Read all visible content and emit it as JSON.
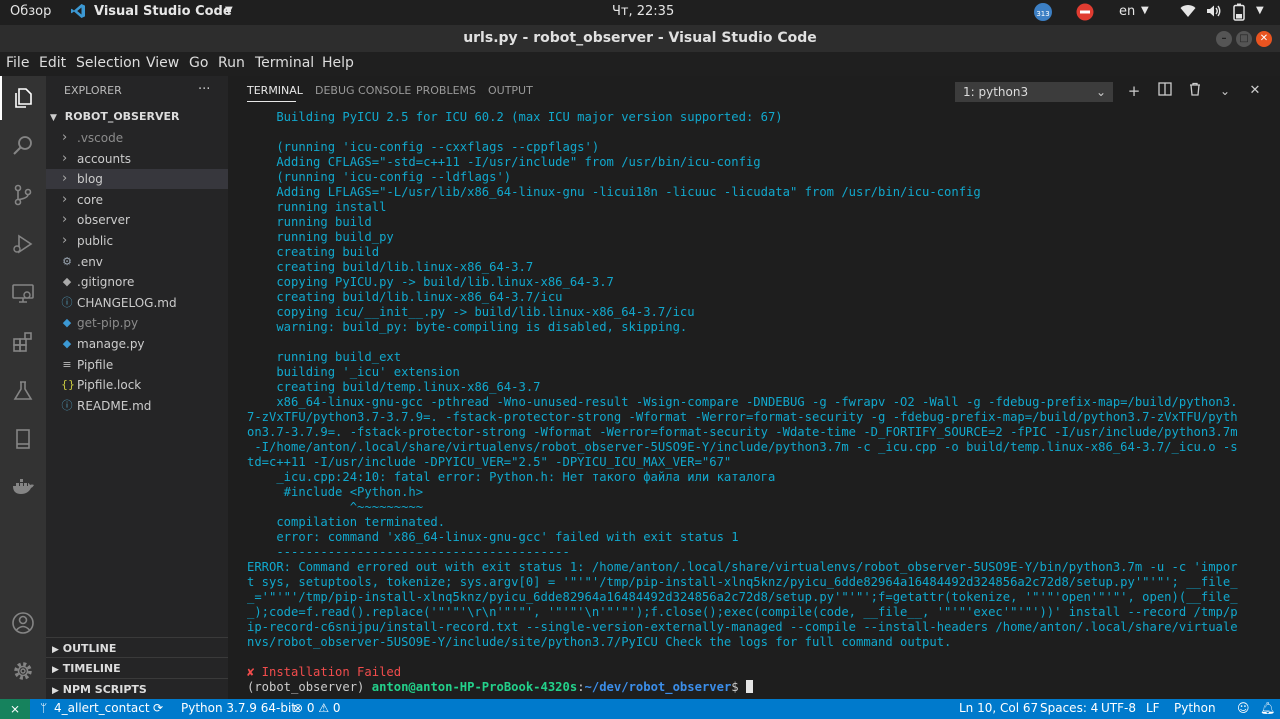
{
  "gnome": {
    "activities": "Обзор",
    "app_name": "Visual Studio Code",
    "clock": "Чт, 22:35",
    "lang": "en",
    "update_badge": "313"
  },
  "window": {
    "title": "urls.py - robot_observer - Visual Studio Code"
  },
  "menu": [
    "File",
    "Edit",
    "Selection",
    "View",
    "Go",
    "Run",
    "Terminal",
    "Help"
  ],
  "activity_icons": [
    "explorer-icon",
    "search-icon",
    "source-control-icon",
    "run-debug-icon",
    "remote-explorer-icon",
    "extensions-icon",
    "testing-icon",
    "bookmark-icon",
    "docker-icon",
    "account-icon",
    "settings-gear-icon"
  ],
  "sidebar": {
    "header": "EXPLORER",
    "more": "···",
    "project": "ROBOT_OBSERVER",
    "items": [
      {
        "label": ".vscode",
        "kind": "folder",
        "muted": true
      },
      {
        "label": "accounts",
        "kind": "folder"
      },
      {
        "label": "blog",
        "kind": "folder",
        "selected": true
      },
      {
        "label": "core",
        "kind": "folder"
      },
      {
        "label": "observer",
        "kind": "folder"
      },
      {
        "label": "public",
        "kind": "folder"
      },
      {
        "label": ".env",
        "kind": "file",
        "icon": "gear"
      },
      {
        "label": ".gitignore",
        "kind": "file",
        "icon": "git"
      },
      {
        "label": "CHANGELOG.md",
        "kind": "file",
        "icon": "info"
      },
      {
        "label": "get-pip.py",
        "kind": "file",
        "icon": "python",
        "muted": true
      },
      {
        "label": "manage.py",
        "kind": "file",
        "icon": "python"
      },
      {
        "label": "Pipfile",
        "kind": "file",
        "icon": "lines"
      },
      {
        "label": "Pipfile.lock",
        "kind": "file",
        "icon": "braces"
      },
      {
        "label": "README.md",
        "kind": "file",
        "icon": "info"
      }
    ],
    "sections": [
      "OUTLINE",
      "TIMELINE",
      "NPM SCRIPTS"
    ]
  },
  "panel": {
    "tabs": [
      "TERMINAL",
      "DEBUG CONSOLE",
      "PROBLEMS",
      "OUTPUT"
    ],
    "active_tab": "TERMINAL",
    "terminal_select": "1: python3",
    "actions": [
      "plus-icon",
      "split-icon",
      "trash-icon",
      "chevron-down-icon",
      "close-icon"
    ]
  },
  "terminal": {
    "lines": [
      {
        "t": "    Building PyICU 2.5 for ICU 60.2 (max ICU major version supported: 67)"
      },
      {
        "t": ""
      },
      {
        "t": "    (running 'icu-config --cxxflags --cppflags')"
      },
      {
        "t": "    Adding CFLAGS=\"-std=c++11 -I/usr/include\" from /usr/bin/icu-config"
      },
      {
        "t": "    (running 'icu-config --ldflags')"
      },
      {
        "t": "    Adding LFLAGS=\"-L/usr/lib/x86_64-linux-gnu -licui18n -licuuc -licudata\" from /usr/bin/icu-config"
      },
      {
        "t": "    running install"
      },
      {
        "t": "    running build"
      },
      {
        "t": "    running build_py"
      },
      {
        "t": "    creating build"
      },
      {
        "t": "    creating build/lib.linux-x86_64-3.7"
      },
      {
        "t": "    copying PyICU.py -> build/lib.linux-x86_64-3.7"
      },
      {
        "t": "    creating build/lib.linux-x86_64-3.7/icu"
      },
      {
        "t": "    copying icu/__init__.py -> build/lib.linux-x86_64-3.7/icu"
      },
      {
        "t": "    warning: build_py: byte-compiling is disabled, skipping."
      },
      {
        "t": ""
      },
      {
        "t": "    running build_ext"
      },
      {
        "t": "    building '_icu' extension"
      },
      {
        "t": "    creating build/temp.linux-x86_64-3.7"
      },
      {
        "t": "    x86_64-linux-gnu-gcc -pthread -Wno-unused-result -Wsign-compare -DNDEBUG -g -fwrapv -O2 -Wall -g -fdebug-prefix-map=/build/python3."
      },
      {
        "t": "7-zVxTFU/python3.7-3.7.9=. -fstack-protector-strong -Wformat -Werror=format-security -g -fdebug-prefix-map=/build/python3.7-zVxTFU/pyth"
      },
      {
        "t": "on3.7-3.7.9=. -fstack-protector-strong -Wformat -Werror=format-security -Wdate-time -D_FORTIFY_SOURCE=2 -fPIC -I/usr/include/python3.7m"
      },
      {
        "t": " -I/home/anton/.local/share/virtualenvs/robot_observer-5USO9E-Y/include/python3.7m -c _icu.cpp -o build/temp.linux-x86_64-3.7/_icu.o -s"
      },
      {
        "t": "td=c++11 -I/usr/include -DPYICU_VER=\"2.5\" -DPYICU_ICU_MAX_VER=\"67\""
      },
      {
        "t": "    _icu.cpp:24:10: fatal error: Python.h: Нет такого файла или каталога"
      },
      {
        "t": "     #include <Python.h>"
      },
      {
        "t": "              ^~~~~~~~~~"
      },
      {
        "t": "    compilation terminated."
      },
      {
        "t": "    error: command 'x86_64-linux-gnu-gcc' failed with exit status 1"
      },
      {
        "t": "    ----------------------------------------"
      },
      {
        "t": "ERROR: Command errored out with exit status 1: /home/anton/.local/share/virtualenvs/robot_observer-5USO9E-Y/bin/python3.7m -u -c 'impor"
      },
      {
        "t": "t sys, setuptools, tokenize; sys.argv[0] = '\"'\"'/tmp/pip-install-xlnq5knz/pyicu_6dde82964a16484492d324856a2c72d8/setup.py'\"'\"'; __file_"
      },
      {
        "t": "_='\"'\"'/tmp/pip-install-xlnq5knz/pyicu_6dde82964a16484492d324856a2c72d8/setup.py'\"'\"';f=getattr(tokenize, '\"'\"'open'\"'\"', open)(__file_"
      },
      {
        "t": "_);code=f.read().replace('\"'\"'\\r\\n'\"'\"', '\"'\"'\\n'\"'\"');f.close();exec(compile(code, __file__, '\"'\"'exec'\"'\"'))' install --record /tmp/p"
      },
      {
        "t": "ip-record-c6snijpu/install-record.txt --single-version-externally-managed --compile --install-headers /home/anton/.local/share/virtuale"
      },
      {
        "t": "nvs/robot_observer-5USO9E-Y/include/site/python3.7/PyICU Check the logs for full command output."
      },
      {
        "t": ""
      },
      {
        "t": "✘ Installation Failed",
        "cls": "red"
      }
    ],
    "prompt": {
      "env": "(robot_observer) ",
      "user": "anton@anton-HP-ProBook-4320s",
      "sep": ":",
      "path": "~/dev/robot_observer",
      "end": "$ "
    }
  },
  "statusbar": {
    "remote": "⨯",
    "branch": "4_allert_contact",
    "sync": "⟳",
    "python": "Python 3.7.9 64-bit",
    "problems": "⊗ 0 ⚠ 0",
    "position": "Ln 10, Col 67",
    "spaces": "Spaces: 4",
    "encoding": "UTF-8",
    "eol": "LF",
    "language": "Python"
  },
  "colors": {
    "accent": "#007acc",
    "terminal_text": "#11a8cd",
    "error": "#f14c4c",
    "prompt_user": "#23d18b",
    "prompt_path": "#3b8eea"
  }
}
